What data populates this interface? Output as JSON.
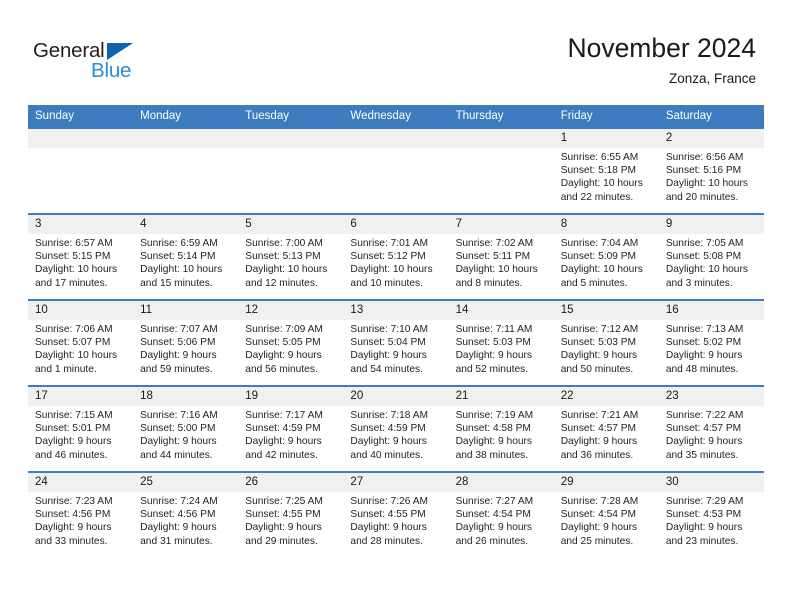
{
  "brand": {
    "name_part1": "General",
    "name_part2": "Blue",
    "triangle_color": "#0d63ae",
    "blue_color": "#2a8fd4"
  },
  "header": {
    "title": "November 2024",
    "location": "Zonza, France"
  },
  "theme": {
    "header_blue": "#3c7cbf",
    "daynum_bg": "#f0f0f0",
    "text": "#231f20"
  },
  "weekdays": [
    "Sunday",
    "Monday",
    "Tuesday",
    "Wednesday",
    "Thursday",
    "Friday",
    "Saturday"
  ],
  "weeks": [
    [
      {
        "day": "",
        "empty": true,
        "lines": []
      },
      {
        "day": "",
        "empty": true,
        "lines": []
      },
      {
        "day": "",
        "empty": true,
        "lines": []
      },
      {
        "day": "",
        "empty": true,
        "lines": []
      },
      {
        "day": "",
        "empty": true,
        "lines": []
      },
      {
        "day": "1",
        "empty": false,
        "lines": [
          "Sunrise: 6:55 AM",
          "Sunset: 5:18 PM",
          "Daylight: 10 hours",
          "and 22 minutes."
        ]
      },
      {
        "day": "2",
        "empty": false,
        "lines": [
          "Sunrise: 6:56 AM",
          "Sunset: 5:16 PM",
          "Daylight: 10 hours",
          "and 20 minutes."
        ]
      }
    ],
    [
      {
        "day": "3",
        "empty": false,
        "lines": [
          "Sunrise: 6:57 AM",
          "Sunset: 5:15 PM",
          "Daylight: 10 hours",
          "and 17 minutes."
        ]
      },
      {
        "day": "4",
        "empty": false,
        "lines": [
          "Sunrise: 6:59 AM",
          "Sunset: 5:14 PM",
          "Daylight: 10 hours",
          "and 15 minutes."
        ]
      },
      {
        "day": "5",
        "empty": false,
        "lines": [
          "Sunrise: 7:00 AM",
          "Sunset: 5:13 PM",
          "Daylight: 10 hours",
          "and 12 minutes."
        ]
      },
      {
        "day": "6",
        "empty": false,
        "lines": [
          "Sunrise: 7:01 AM",
          "Sunset: 5:12 PM",
          "Daylight: 10 hours",
          "and 10 minutes."
        ]
      },
      {
        "day": "7",
        "empty": false,
        "lines": [
          "Sunrise: 7:02 AM",
          "Sunset: 5:11 PM",
          "Daylight: 10 hours",
          "and 8 minutes."
        ]
      },
      {
        "day": "8",
        "empty": false,
        "lines": [
          "Sunrise: 7:04 AM",
          "Sunset: 5:09 PM",
          "Daylight: 10 hours",
          "and 5 minutes."
        ]
      },
      {
        "day": "9",
        "empty": false,
        "lines": [
          "Sunrise: 7:05 AM",
          "Sunset: 5:08 PM",
          "Daylight: 10 hours",
          "and 3 minutes."
        ]
      }
    ],
    [
      {
        "day": "10",
        "empty": false,
        "lines": [
          "Sunrise: 7:06 AM",
          "Sunset: 5:07 PM",
          "Daylight: 10 hours",
          "and 1 minute."
        ]
      },
      {
        "day": "11",
        "empty": false,
        "lines": [
          "Sunrise: 7:07 AM",
          "Sunset: 5:06 PM",
          "Daylight: 9 hours",
          "and 59 minutes."
        ]
      },
      {
        "day": "12",
        "empty": false,
        "lines": [
          "Sunrise: 7:09 AM",
          "Sunset: 5:05 PM",
          "Daylight: 9 hours",
          "and 56 minutes."
        ]
      },
      {
        "day": "13",
        "empty": false,
        "lines": [
          "Sunrise: 7:10 AM",
          "Sunset: 5:04 PM",
          "Daylight: 9 hours",
          "and 54 minutes."
        ]
      },
      {
        "day": "14",
        "empty": false,
        "lines": [
          "Sunrise: 7:11 AM",
          "Sunset: 5:03 PM",
          "Daylight: 9 hours",
          "and 52 minutes."
        ]
      },
      {
        "day": "15",
        "empty": false,
        "lines": [
          "Sunrise: 7:12 AM",
          "Sunset: 5:03 PM",
          "Daylight: 9 hours",
          "and 50 minutes."
        ]
      },
      {
        "day": "16",
        "empty": false,
        "lines": [
          "Sunrise: 7:13 AM",
          "Sunset: 5:02 PM",
          "Daylight: 9 hours",
          "and 48 minutes."
        ]
      }
    ],
    [
      {
        "day": "17",
        "empty": false,
        "lines": [
          "Sunrise: 7:15 AM",
          "Sunset: 5:01 PM",
          "Daylight: 9 hours",
          "and 46 minutes."
        ]
      },
      {
        "day": "18",
        "empty": false,
        "lines": [
          "Sunrise: 7:16 AM",
          "Sunset: 5:00 PM",
          "Daylight: 9 hours",
          "and 44 minutes."
        ]
      },
      {
        "day": "19",
        "empty": false,
        "lines": [
          "Sunrise: 7:17 AM",
          "Sunset: 4:59 PM",
          "Daylight: 9 hours",
          "and 42 minutes."
        ]
      },
      {
        "day": "20",
        "empty": false,
        "lines": [
          "Sunrise: 7:18 AM",
          "Sunset: 4:59 PM",
          "Daylight: 9 hours",
          "and 40 minutes."
        ]
      },
      {
        "day": "21",
        "empty": false,
        "lines": [
          "Sunrise: 7:19 AM",
          "Sunset: 4:58 PM",
          "Daylight: 9 hours",
          "and 38 minutes."
        ]
      },
      {
        "day": "22",
        "empty": false,
        "lines": [
          "Sunrise: 7:21 AM",
          "Sunset: 4:57 PM",
          "Daylight: 9 hours",
          "and 36 minutes."
        ]
      },
      {
        "day": "23",
        "empty": false,
        "lines": [
          "Sunrise: 7:22 AM",
          "Sunset: 4:57 PM",
          "Daylight: 9 hours",
          "and 35 minutes."
        ]
      }
    ],
    [
      {
        "day": "24",
        "empty": false,
        "lines": [
          "Sunrise: 7:23 AM",
          "Sunset: 4:56 PM",
          "Daylight: 9 hours",
          "and 33 minutes."
        ]
      },
      {
        "day": "25",
        "empty": false,
        "lines": [
          "Sunrise: 7:24 AM",
          "Sunset: 4:56 PM",
          "Daylight: 9 hours",
          "and 31 minutes."
        ]
      },
      {
        "day": "26",
        "empty": false,
        "lines": [
          "Sunrise: 7:25 AM",
          "Sunset: 4:55 PM",
          "Daylight: 9 hours",
          "and 29 minutes."
        ]
      },
      {
        "day": "27",
        "empty": false,
        "lines": [
          "Sunrise: 7:26 AM",
          "Sunset: 4:55 PM",
          "Daylight: 9 hours",
          "and 28 minutes."
        ]
      },
      {
        "day": "28",
        "empty": false,
        "lines": [
          "Sunrise: 7:27 AM",
          "Sunset: 4:54 PM",
          "Daylight: 9 hours",
          "and 26 minutes."
        ]
      },
      {
        "day": "29",
        "empty": false,
        "lines": [
          "Sunrise: 7:28 AM",
          "Sunset: 4:54 PM",
          "Daylight: 9 hours",
          "and 25 minutes."
        ]
      },
      {
        "day": "30",
        "empty": false,
        "lines": [
          "Sunrise: 7:29 AM",
          "Sunset: 4:53 PM",
          "Daylight: 9 hours",
          "and 23 minutes."
        ]
      }
    ]
  ]
}
